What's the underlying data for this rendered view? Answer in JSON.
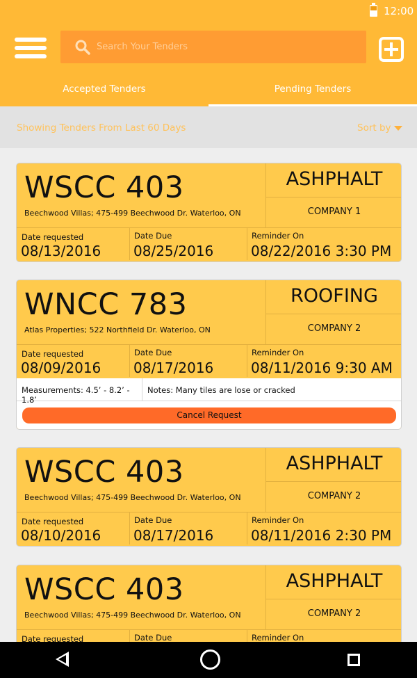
{
  "status_bar": {
    "time": "12:00"
  },
  "app_bar": {
    "search_placeholder": "Search Your Tenders",
    "tabs": [
      {
        "label": "Accepted Tenders",
        "selected": false
      },
      {
        "label": "Pending Tenders",
        "selected": true
      }
    ]
  },
  "filter": {
    "text": "Showing Tenders From Last 60 Days",
    "sort_label": "Sort by"
  },
  "labels": {
    "date_requested": "Date requested",
    "date_due": "Date Due",
    "reminder_on": "Reminder On"
  },
  "tenders": [
    {
      "code": "WSCC 403",
      "address": "Beechwood Villas; 475-499 Beechwood Dr. Waterloo, ON",
      "category": "ASHPHALT",
      "company": "COMPANY 1",
      "date_requested": "08/13/2016",
      "date_due": "08/25/2016",
      "reminder": "08/22/2016 3:30 PM"
    },
    {
      "code": "WNCC 783",
      "address": "Atlas Properties; 522 Northfield Dr. Waterloo, ON",
      "category": "ROOFING",
      "company": "COMPANY 2",
      "date_requested": "08/09/2016",
      "date_due": "08/17/2016",
      "reminder": "08/11/2016 9:30 AM",
      "measurements": "Measurements: 4.5’ - 8.2’ - 1.8’",
      "notes": "Notes: Many tiles are lose or cracked",
      "cancel_label": "Cancel Request"
    },
    {
      "code": "WSCC 403",
      "address": "Beechwood Villas; 475-499 Beechwood Dr. Waterloo, ON",
      "category": "ASHPHALT",
      "company": "COMPANY 2",
      "date_requested": "08/10/2016",
      "date_due": "08/17/2016",
      "reminder": "08/11/2016 2:30 PM"
    },
    {
      "code": "WSCC 403",
      "address": "Beechwood Villas; 475-499 Beechwood Dr. Waterloo, ON",
      "category": "ASHPHALT",
      "company": "COMPANY 2"
    }
  ],
  "colors": {
    "primary": "#ffb936",
    "card": "#ffca4c",
    "search_bg": "#ff9c33",
    "cancel": "#ff6a28",
    "filter_text": "#ffc25a"
  }
}
